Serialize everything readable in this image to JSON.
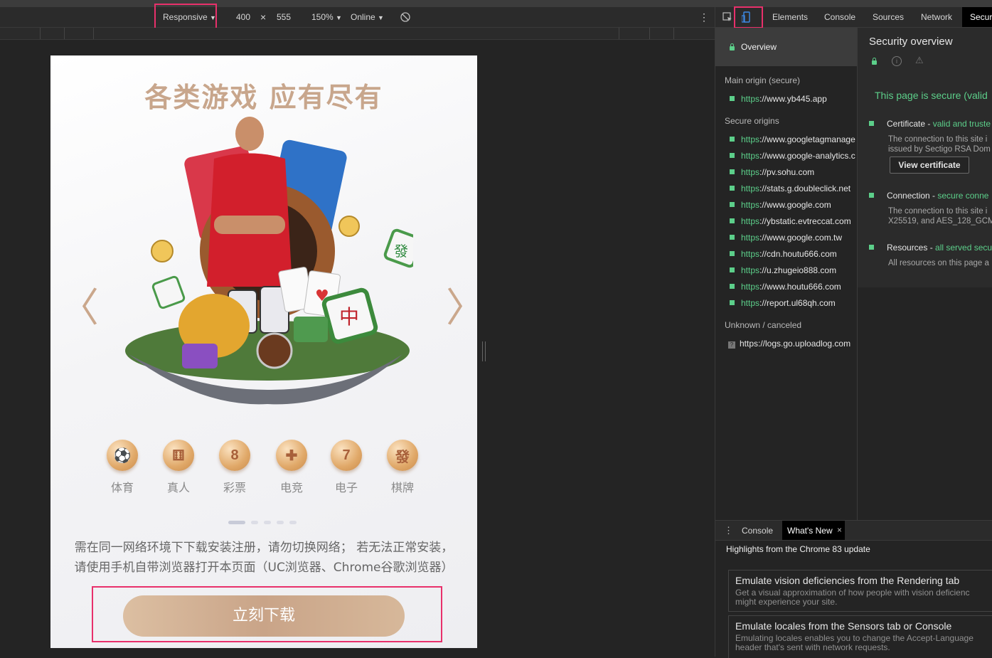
{
  "device_toolbar": {
    "device": "Responsive",
    "width": "400",
    "times": "×",
    "height": "555",
    "zoom": "150%",
    "network": "Online"
  },
  "devtools": {
    "tabs": [
      "Elements",
      "Console",
      "Sources",
      "Network",
      "Secur"
    ],
    "security": {
      "overview_label": "Overview",
      "main_origin_heading": "Main origin (secure)",
      "main_origin": {
        "scheme": "https",
        "host": "://www.yb445.app"
      },
      "secure_origins_heading": "Secure origins",
      "secure_origins": [
        {
          "scheme": "https",
          "host": "://www.googletagmanage"
        },
        {
          "scheme": "https",
          "host": "://www.google-analytics.c"
        },
        {
          "scheme": "https",
          "host": "://pv.sohu.com"
        },
        {
          "scheme": "https",
          "host": "://stats.g.doubleclick.net"
        },
        {
          "scheme": "https",
          "host": "://www.google.com"
        },
        {
          "scheme": "https",
          "host": "://ybstatic.evtreccat.com"
        },
        {
          "scheme": "https",
          "host": "://www.google.com.tw"
        },
        {
          "scheme": "https",
          "host": "://cdn.houtu666.com"
        },
        {
          "scheme": "https",
          "host": "://u.zhugeio888.com"
        },
        {
          "scheme": "https",
          "host": "://www.houtu666.com"
        },
        {
          "scheme": "https",
          "host": "://report.ul68qh.com"
        }
      ],
      "unknown_heading": "Unknown / canceled",
      "unknown_origin": {
        "scheme": "https",
        "host": "://logs.go.uploadlog.com"
      },
      "overview_title": "Security overview",
      "secure_message": "This page is secure (valid",
      "certificate": {
        "label": "Certificate - ",
        "status": "valid and truste",
        "desc1": "The connection to this site i",
        "desc2": "issued by Sectigo RSA Dom",
        "button": "View certificate"
      },
      "connection": {
        "label": "Connection - ",
        "status": "secure conne",
        "desc1": "The connection to this site i",
        "desc2": "X25519, and AES_128_GCM"
      },
      "resources": {
        "label": "Resources - ",
        "status": "all served secu",
        "desc1": "All resources on this page a"
      }
    },
    "drawer": {
      "tabs": [
        "Console",
        "What's New"
      ],
      "close": "×",
      "heading": "Highlights from the Chrome 83 update",
      "cards": [
        {
          "title": "Emulate vision deficiencies from the Rendering tab",
          "desc1": "Get a visual approximation of how people with vision deficienc",
          "desc2": "might experience your site."
        },
        {
          "title": "Emulate locales from the Sensors tab or Console",
          "desc1": "Emulating locales enables you to change the Accept-Language",
          "desc2": "header that's sent with network requests."
        }
      ]
    }
  },
  "page": {
    "headline": "各类游戏 应有尽有",
    "prev_arrow": "〈",
    "next_arrow": "〉",
    "categories": [
      {
        "label": "体育",
        "icon": "soccer-ball-icon",
        "glyph": "⚽"
      },
      {
        "label": "真人",
        "icon": "dice-icon",
        "glyph": "⚅"
      },
      {
        "label": "彩票",
        "icon": "lottery-ball-icon",
        "glyph": "8"
      },
      {
        "label": "电竞",
        "icon": "gamepad-icon",
        "glyph": "✚"
      },
      {
        "label": "电子",
        "icon": "slot-machine-icon",
        "glyph": "7"
      },
      {
        "label": "棋牌",
        "icon": "mahjong-tile-icon",
        "glyph": "發"
      }
    ],
    "notice_line1": "需在同一网络环境下下载安装注册，请勿切换网络； 若无法正常安装，",
    "notice_line2": "请使用手机自带浏览器打开本页面（UC浏览器、Chrome谷歌浏览器）",
    "download_button": "立刻下载",
    "hero_tile_char": "中",
    "hero_tile_char2": "發"
  },
  "colors": {
    "accent_pink": "#e8306b",
    "secure_green": "#5ccf8a",
    "gold": "#c9a488"
  }
}
